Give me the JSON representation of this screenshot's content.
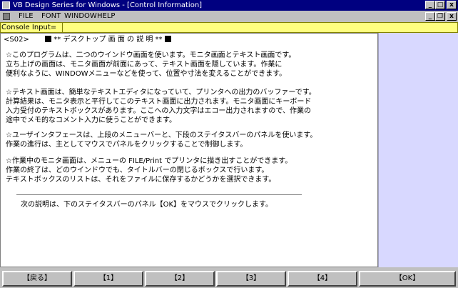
{
  "window": {
    "title": "VB Design Series for Windows - [Control Information]",
    "controls": {
      "minimize": "_",
      "maximize": "□",
      "close": "x"
    },
    "mdi_controls": {
      "minimize": "_",
      "restore": "❐",
      "close": "x"
    }
  },
  "menu": [
    "FILE",
    "FONT",
    "WINDOW",
    "HELP"
  ],
  "console": {
    "label": "Console Input=",
    "value": ""
  },
  "content": {
    "header_id": "<S02>",
    "header_title": "** デスクトップ 画 面 の 説 明 **",
    "paragraphs": [
      [
        "☆このプログラムは、二つのウインドウ画面を使います。モニタ画面とテキスト画面です。",
        "  立ち上げの画面は、モニタ画面が前面にあって、テキスト画面を隠しています。作業に",
        "  便利なように、WINDOWメニューなどを使って、位置や寸法を変えることができます。"
      ],
      [
        "☆テキスト画面は、簡単なテキストエディタになっていて、プリンタへの出力のバッファーです。",
        "  計算結果は、モニタ表示と平行してこのテキスト画面に出力されます。モニタ画面にキーボード",
        "  入力受付のテキストボックスがあります。ここへの入力文字はエコー出力されますので、作業の",
        "  途中でメモ的なコメント入力に使うことができます。"
      ],
      [
        "☆ユーザインタフェースは、上段のメニューバーと、下段のステイタスバーのパネルを使います。",
        "  作業の進行は、主としてマウスでパネルをクリックすることで制御します。"
      ],
      [
        "☆作業中のモニタ画面は、メニューの FILE/Print でプリンタに描き出すことができます。",
        "  作業の終了は、どのウインドウでも、タイトルバーの閉じるボックスで行います。",
        "  テキストボックスのリストは、それをファイルに保存するかどうかを選択できます。"
      ]
    ],
    "note": "次の説明は、下のステイタスバーのパネル【OK】をマウスでクリックします。"
  },
  "status_buttons": [
    "【戻る】",
    "【1】",
    "【2】",
    "【3】",
    "【4】",
    "【OK】"
  ],
  "colors": {
    "title_bg": "#000080",
    "console_bg": "#ffff80",
    "right_panel_bg": "#d8d8ff"
  }
}
